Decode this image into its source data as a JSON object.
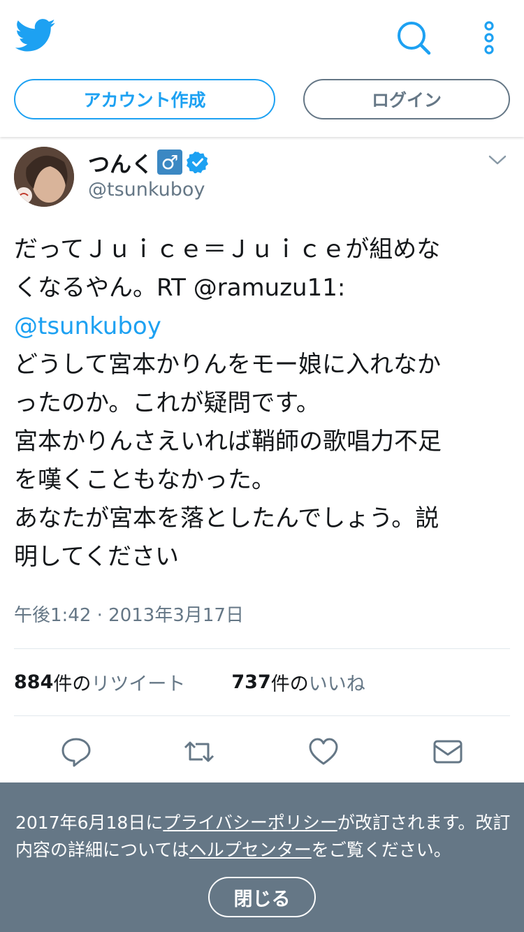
{
  "header": {
    "logo_icon": "twitter-bird-icon",
    "search_icon": "search-icon",
    "more_icon": "vertical-ellipsis-icon",
    "signup_label": "アカウント作成",
    "login_label": "ログイン"
  },
  "tweet": {
    "author_name": "つんく",
    "gender_badge": "♂",
    "handle": "@tsunkuboy",
    "lines": [
      "だってＪｕｉｃｅ＝Ｊｕｉｃｅが組めな",
      "くなるやん。RT @ramuzu11:",
      "@tsunkuboy",
      "どうして宮本かりんをモー娘に入れなか",
      "ったのか。これが疑問です。",
      "宮本かりんさえいれば鞘師の歌唱力不足",
      "を嘆くこともなかった。",
      "あなたが宮本を落としたんでしょう。説",
      "明してください"
    ],
    "timestamp": "午後1:42 · 2013年3月17日",
    "retweets": {
      "count": "884",
      "suffix": "件の",
      "label": "リツイート"
    },
    "likes": {
      "count": "737",
      "suffix": "件の",
      "label": "いいね"
    }
  },
  "actions": [
    "reply-icon",
    "retweet-icon",
    "like-icon",
    "message-icon"
  ],
  "banner": {
    "text_before": "2017年6月18日に",
    "link1": "プライバシーポリシー",
    "text_middle": "が改訂されます。改訂内容の詳細については",
    "link2": "ヘルプセンター",
    "text_after": "をご覧ください。",
    "close_label": "閉じる"
  },
  "colors": {
    "accent": "#1da1f2",
    "muted": "#657786",
    "banner_bg": "#657786",
    "verified": "#1da1f2"
  }
}
